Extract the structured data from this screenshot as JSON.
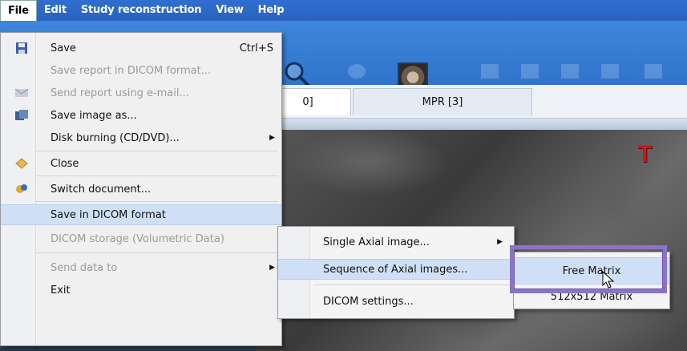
{
  "menubar": {
    "items": [
      "File",
      "Edit",
      "Study reconstruction",
      "View",
      "Help"
    ]
  },
  "tabs": [
    "0]",
    "MPR [3]"
  ],
  "file_menu": {
    "items": [
      {
        "label": "Save",
        "shortcut": "Ctrl+S",
        "disabled": false,
        "icon": "save-icon"
      },
      {
        "label": "Save report in DICOM format...",
        "disabled": true
      },
      {
        "label": "Send report using e-mail...",
        "disabled": true,
        "icon": "email-icon"
      },
      {
        "label": "Save image as...",
        "disabled": false,
        "icon": "save-image-icon"
      },
      {
        "label": "Disk burning (CD/DVD)...",
        "disabled": false,
        "submenu": true
      },
      {
        "label": "Close",
        "disabled": false,
        "icon": "close-doc-icon"
      },
      {
        "label": "Switch document...",
        "disabled": false,
        "icon": "switch-doc-icon"
      },
      {
        "label": "Save in DICOM format",
        "disabled": false,
        "submenu": true,
        "highlighted": true
      },
      {
        "label": "DICOM storage (Volumetric Data)",
        "disabled": true
      },
      {
        "label": "Send data to",
        "disabled": true,
        "submenu": true
      },
      {
        "label": "Exit",
        "disabled": false
      }
    ]
  },
  "dicom_submenu": {
    "items": [
      {
        "label": "Single Axial image...",
        "submenu": true
      },
      {
        "label": "Sequence of Axial images...",
        "submenu": true,
        "highlighted": true
      },
      {
        "label": "DICOM settings..."
      }
    ]
  },
  "sequence_submenu": {
    "items": [
      {
        "label": "Free Matrix",
        "highlighted": true
      },
      {
        "label": "512x512 Matrix"
      }
    ]
  },
  "viewer": {
    "orientation_marker": "T"
  },
  "colors": {
    "menubar": "#2f6fd0",
    "highlight": "#cfe0f6",
    "callout": "#8c73c8",
    "marker": "#d01818"
  }
}
